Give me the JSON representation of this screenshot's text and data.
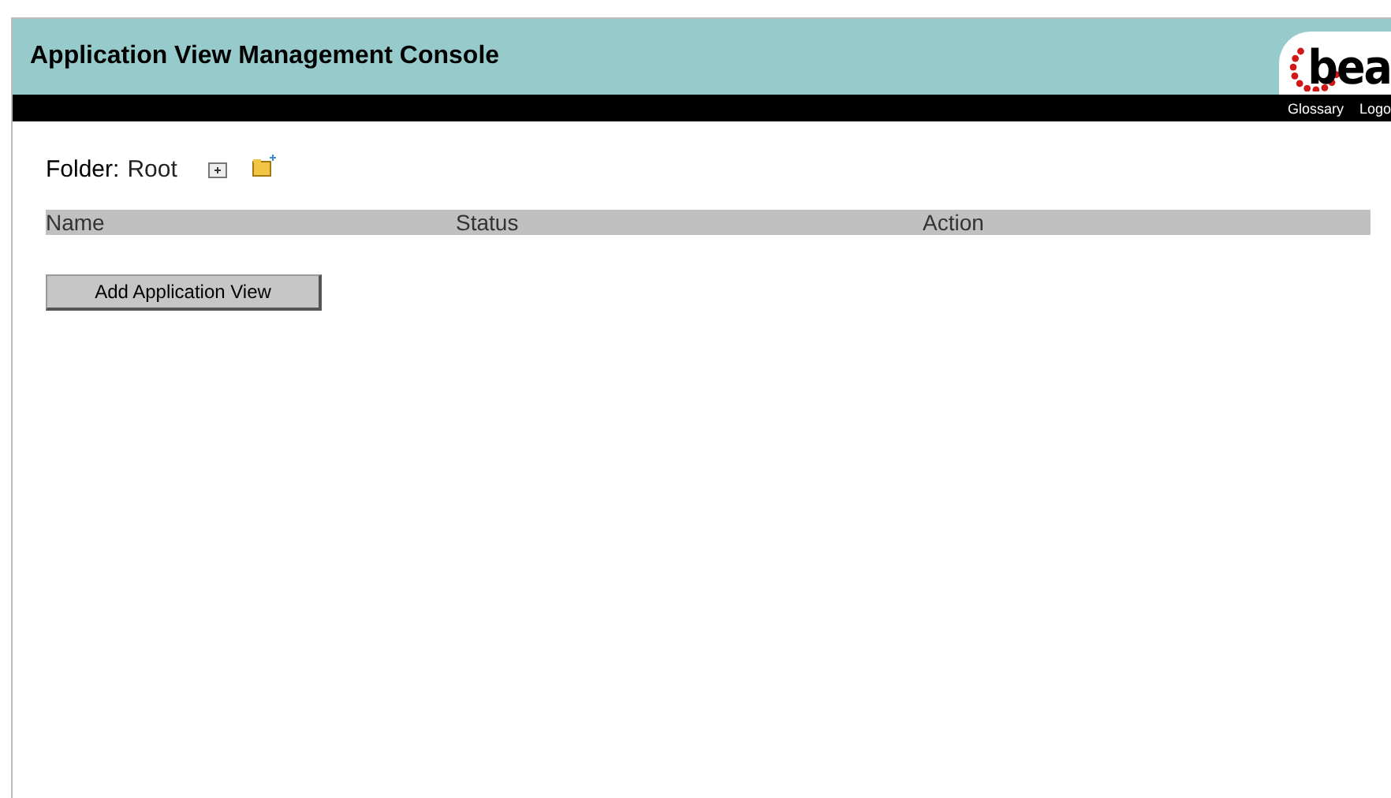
{
  "header": {
    "title": "Application View Management Console",
    "logo": "bea"
  },
  "nav_links": [
    "Glossary",
    "Logo"
  ],
  "folder": {
    "label": "Folder:",
    "name": "Root"
  },
  "table": {
    "columns": [
      "Name",
      "Status",
      "Action"
    ]
  },
  "buttons": [
    "Add Application View"
  ]
}
